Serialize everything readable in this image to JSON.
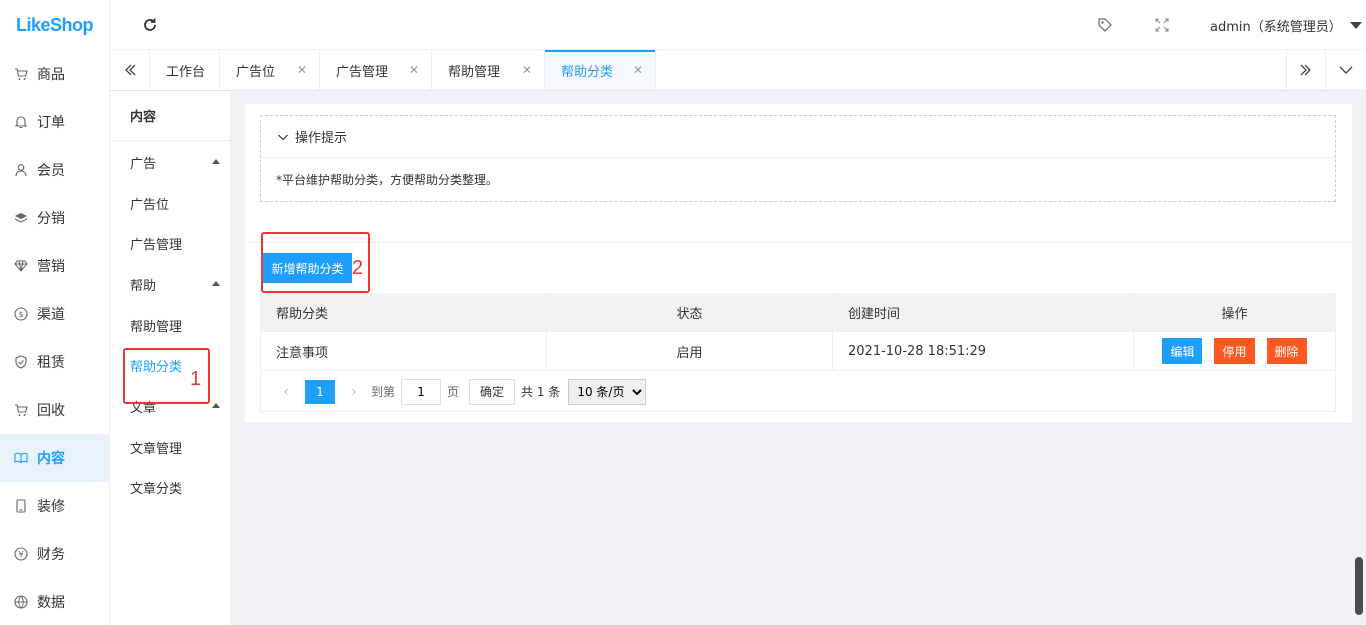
{
  "logo": "LikeShop",
  "nav": [
    {
      "label": "商品",
      "icon": "cart-icon"
    },
    {
      "label": "订单",
      "icon": "bell-icon"
    },
    {
      "label": "会员",
      "icon": "user-icon"
    },
    {
      "label": "分销",
      "icon": "layers-icon"
    },
    {
      "label": "营销",
      "icon": "diamond-icon"
    },
    {
      "label": "渠道",
      "icon": "dollar-icon"
    },
    {
      "label": "租赁",
      "icon": "shield-icon"
    },
    {
      "label": "回收",
      "icon": "cart-icon"
    },
    {
      "label": "内容",
      "icon": "book-icon"
    },
    {
      "label": "装修",
      "icon": "tablet-icon"
    },
    {
      "label": "财务",
      "icon": "yen-icon"
    },
    {
      "label": "数据",
      "icon": "globe-icon"
    }
  ],
  "header": {
    "user": "admin（系统管理员）"
  },
  "tabs": [
    {
      "label": "工作台"
    },
    {
      "label": "广告位"
    },
    {
      "label": "广告管理"
    },
    {
      "label": "帮助管理"
    },
    {
      "label": "帮助分类"
    }
  ],
  "subnav": {
    "title": "内容",
    "groups": [
      {
        "label": "广告",
        "items": [
          "广告位",
          "广告管理"
        ]
      },
      {
        "label": "帮助",
        "items": [
          "帮助管理",
          "帮助分类"
        ]
      },
      {
        "label": "文章",
        "items": [
          "文章管理",
          "文章分类"
        ]
      }
    ]
  },
  "tips": {
    "title": "操作提示",
    "text": "*平台维护帮助分类，方便帮助分类整理。"
  },
  "add_button": "新增帮助分类",
  "annotations": {
    "one": "1",
    "two": "2"
  },
  "table": {
    "headers": [
      "帮助分类",
      "状态",
      "创建时间",
      "操作"
    ],
    "rows": [
      {
        "name": "注意事项",
        "status": "启用",
        "created": "2021-10-28 18:51:29"
      }
    ],
    "actions": {
      "edit": "编辑",
      "disable": "停用",
      "delete": "删除"
    }
  },
  "pager": {
    "current": "1",
    "goto_label": "到第",
    "page_value": "1",
    "page_unit": "页",
    "confirm": "确定",
    "total": "共 1 条",
    "page_size": "10 条/页"
  }
}
